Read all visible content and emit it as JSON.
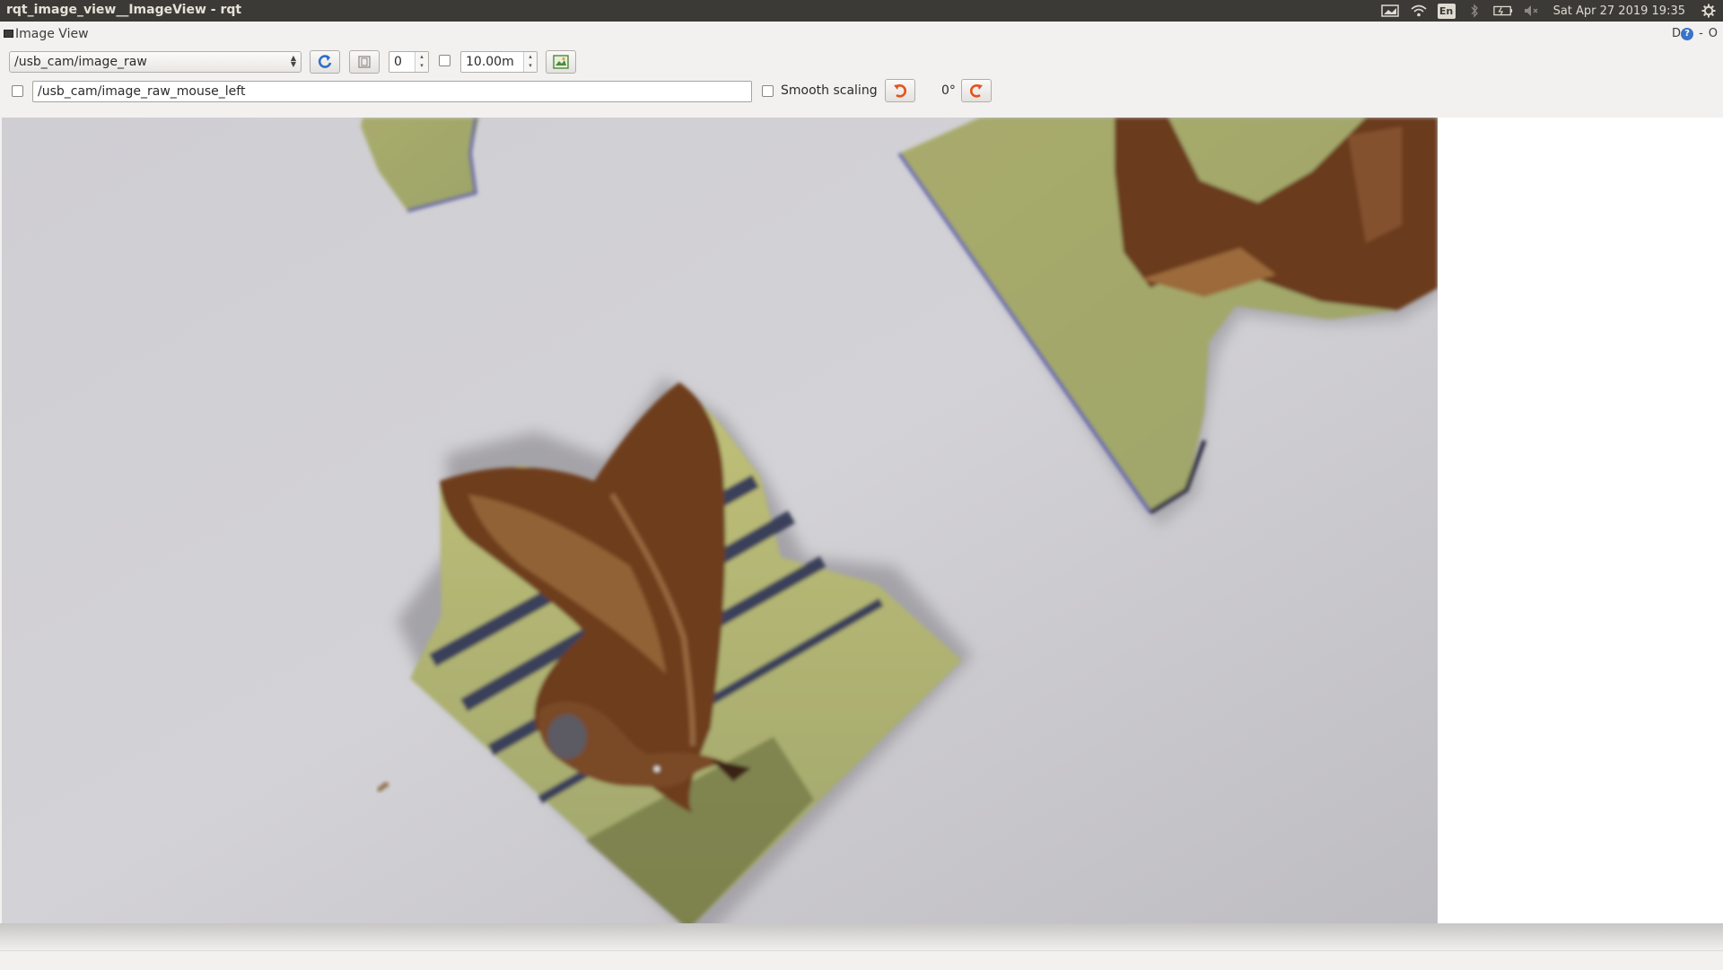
{
  "window": {
    "title": "rqt_image_view__ImageView - rqt"
  },
  "tray": {
    "clock": "Sat Apr 27 2019 19:35",
    "keyboard_layout": "En",
    "icons": [
      "display-icon",
      "wifi-icon",
      "keyboard-icon",
      "bluetooth-icon",
      "battery-icon",
      "volume-muted-icon",
      "settings-gear-icon"
    ]
  },
  "plugin": {
    "title": "Image View",
    "d_label": "D",
    "help_label": "?",
    "minimize_label": "-",
    "close_label": "O"
  },
  "toolbar": {
    "topic": "/usb_cam/image_raw",
    "number_value": "0",
    "max_range_value": "10.00m"
  },
  "mouse_row": {
    "publish_topic": "/usb_cam/image_raw_mouse_left",
    "smooth_scaling_label": "Smooth scaling",
    "rotation_label": "0°"
  },
  "colors": {
    "system_bar": "#3b3a36",
    "accent_blue": "#2f6fc9",
    "rotate_orange": "#e3541c",
    "canvas_gray": "#c9c8cd"
  }
}
